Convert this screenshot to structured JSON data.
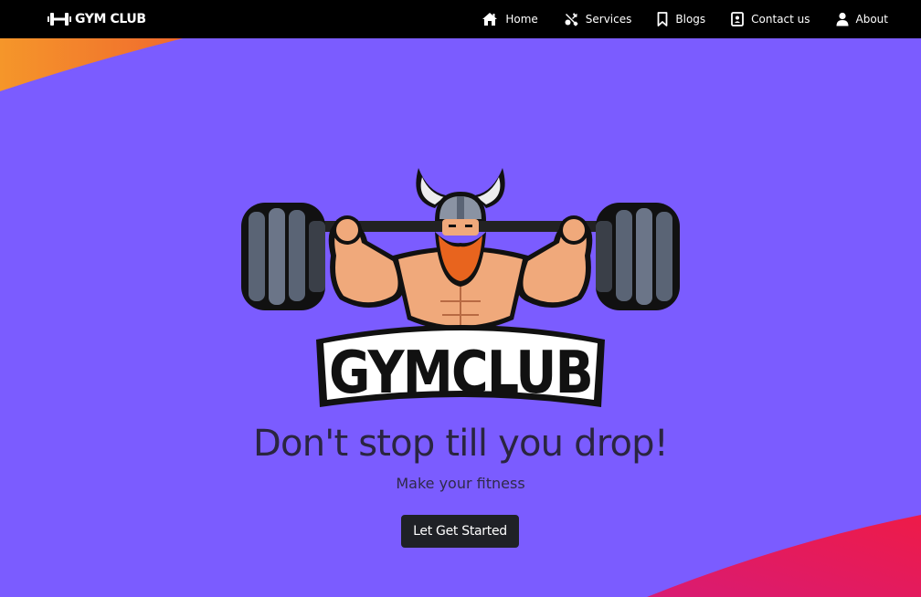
{
  "navbar": {
    "brand": {
      "icon": "dumbbell-icon",
      "text": "GYM CLUB"
    },
    "links": [
      {
        "label": "Home",
        "icon": "home-icon"
      },
      {
        "label": "Services",
        "icon": "tools-icon"
      },
      {
        "label": "Blogs",
        "icon": "bookmark-icon"
      },
      {
        "label": "Contact us",
        "icon": "contact-card-icon"
      },
      {
        "label": "About",
        "icon": "person-icon"
      }
    ]
  },
  "hero": {
    "logo": {
      "text": "GYMCLUB",
      "icon": "viking-weightlifter-logo"
    },
    "headline": "Don't stop till you drop!",
    "subheadline": "Make your fitness",
    "cta_label": "Let Get Started"
  },
  "colors": {
    "background": "#7b5cff",
    "navbar": "#000000",
    "accent_orange": "#f5962a",
    "accent_pink": "#e8205a",
    "button": "#1f2126",
    "headline": "#2a2540"
  }
}
